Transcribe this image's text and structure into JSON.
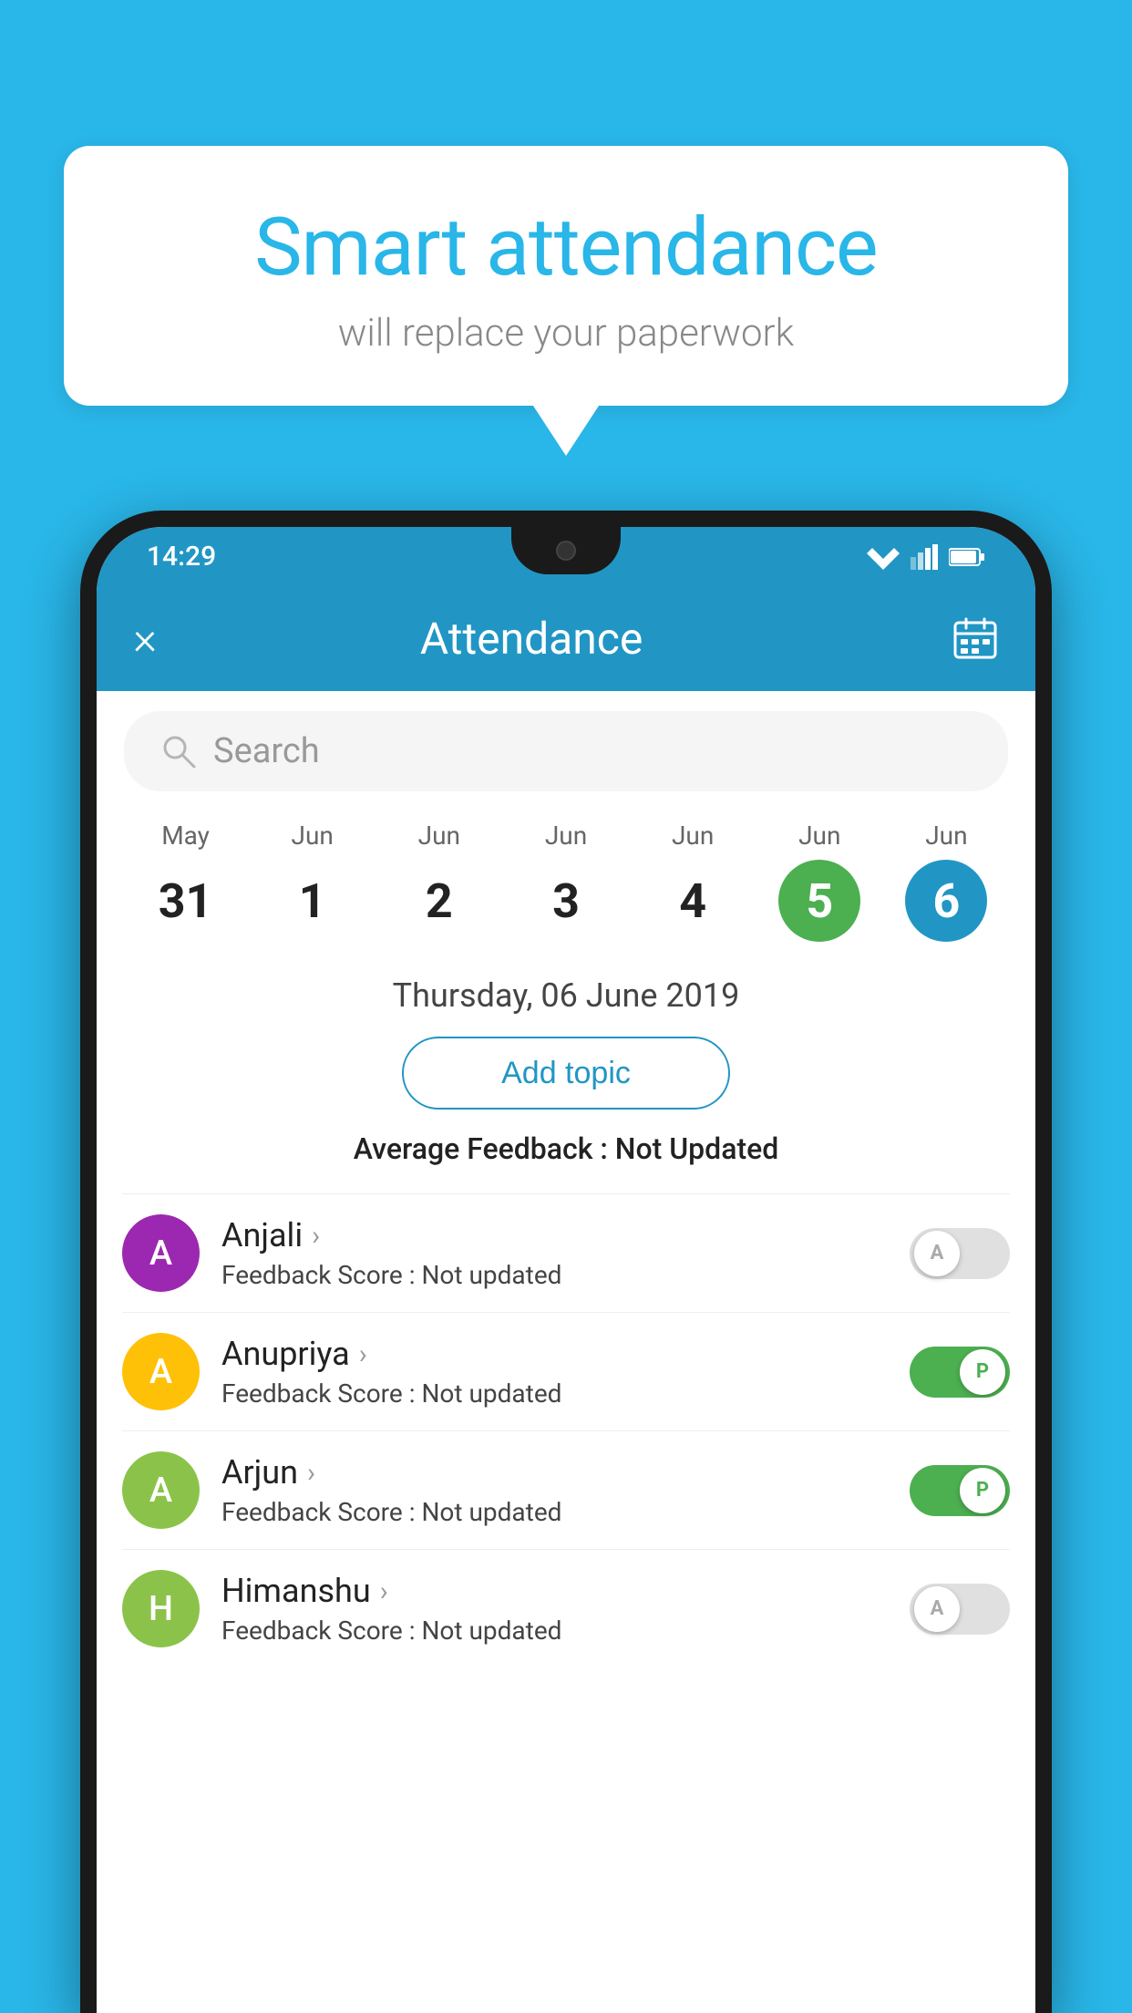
{
  "background_color": "#29B6E8",
  "bubble": {
    "title": "Smart attendance",
    "subtitle": "will replace your paperwork"
  },
  "status_bar": {
    "time": "14:29"
  },
  "app_bar": {
    "title": "Attendance",
    "close_label": "×"
  },
  "search": {
    "placeholder": "Search"
  },
  "calendar": {
    "days": [
      {
        "month": "May",
        "num": "31",
        "style": "normal"
      },
      {
        "month": "Jun",
        "num": "1",
        "style": "normal"
      },
      {
        "month": "Jun",
        "num": "2",
        "style": "normal"
      },
      {
        "month": "Jun",
        "num": "3",
        "style": "normal"
      },
      {
        "month": "Jun",
        "num": "4",
        "style": "normal"
      },
      {
        "month": "Jun",
        "num": "5",
        "style": "green"
      },
      {
        "month": "Jun",
        "num": "6",
        "style": "blue"
      }
    ]
  },
  "selected_date": "Thursday, 06 June 2019",
  "add_topic_label": "Add topic",
  "avg_feedback_label": "Average Feedback :",
  "avg_feedback_value": "Not Updated",
  "students": [
    {
      "name": "Anjali",
      "avatar_letter": "A",
      "avatar_color": "#9C27B0",
      "feedback_label": "Feedback Score :",
      "feedback_value": "Not updated",
      "toggle": "off",
      "toggle_letter": "A"
    },
    {
      "name": "Anupriya",
      "avatar_letter": "A",
      "avatar_color": "#FFC107",
      "feedback_label": "Feedback Score :",
      "feedback_value": "Not updated",
      "toggle": "on",
      "toggle_letter": "P"
    },
    {
      "name": "Arjun",
      "avatar_letter": "A",
      "avatar_color": "#8BC34A",
      "feedback_label": "Feedback Score :",
      "feedback_value": "Not updated",
      "toggle": "on",
      "toggle_letter": "P"
    },
    {
      "name": "Himanshu",
      "avatar_letter": "H",
      "avatar_color": "#8BC34A",
      "feedback_label": "Feedback Score :",
      "feedback_value": "Not updated",
      "toggle": "off",
      "toggle_letter": "A"
    }
  ]
}
